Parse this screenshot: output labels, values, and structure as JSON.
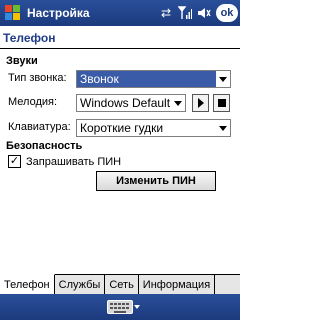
{
  "titlebar": {
    "title": "Настройка",
    "ok_label": "ok",
    "icons": [
      "start-menu-icon",
      "connectivity-icon",
      "signal-icon",
      "volume-icon"
    ]
  },
  "page": {
    "title": "Телефон"
  },
  "sounds": {
    "heading": "Звуки",
    "ring_type_label": "Тип звонка:",
    "ring_type_value": "Звонок",
    "melody_label": "Мелодия:",
    "melody_value": "Windows Default",
    "keyboard_label": "Клавиатура:",
    "keyboard_value": "Короткие гудки"
  },
  "security": {
    "heading": "Безопасность",
    "require_pin_label": "Запрашивать ПИН",
    "require_pin_checked": true,
    "change_pin_label": "Изменить ПИН"
  },
  "tabs": [
    {
      "label": "Телефон",
      "active": true
    },
    {
      "label": "Службы",
      "active": false
    },
    {
      "label": "Сеть",
      "active": false
    },
    {
      "label": "Информация",
      "active": false
    }
  ],
  "colors": {
    "titlebar": "#1c3a7d",
    "accent": "#1f3c88",
    "selection": "#3a5ba8"
  }
}
